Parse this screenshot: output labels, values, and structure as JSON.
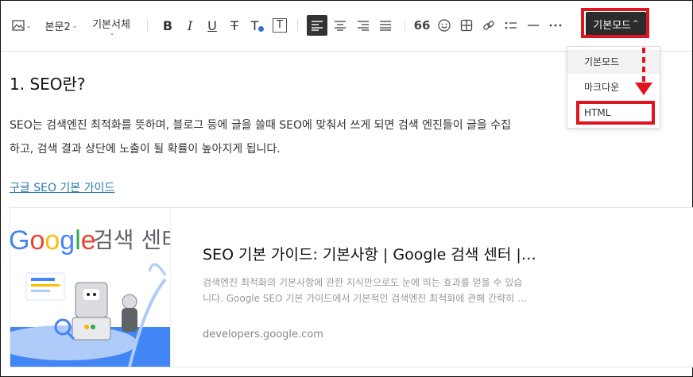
{
  "toolbar": {
    "image_icon": "image-icon",
    "paragraph_style": "본문2",
    "font_family": "기본서체",
    "bold_label": "B",
    "italic_label": "I",
    "underline_label": "U",
    "strike_label": "T",
    "text_color_label": "T",
    "text_bg_label": "T",
    "quote_label": "66",
    "mode_button": "기본모드",
    "mode_caret": "^"
  },
  "mode_menu": {
    "items": [
      {
        "label": "기본모드",
        "active": true
      },
      {
        "label": "마크다운",
        "active": false
      },
      {
        "label": "HTML",
        "active": false
      }
    ]
  },
  "colors": {
    "highlight_red": "#e0141e",
    "link_blue": "#2a7ab0",
    "mode_button_bg": "#2b2b2b",
    "text_color_dot": "#2e6fd8"
  },
  "content": {
    "heading": "1. SEO란?",
    "paragraph_line1": "SEO는 검색엔진 최적화를 뜻하며, 블로그 등에 글을 쓸때 SEO에 맞춰서 쓰게 되면  검색 엔진들이 글을 수집",
    "paragraph_line2": "하고, 검색 결과 상단에 노출이 될 확률이 높아지게 됩니다.",
    "link_text": "구글 SEO 기본 가이드"
  },
  "link_card": {
    "thumb_brand": "Google",
    "thumb_caption": "검색 센터",
    "title": "SEO 기본 가이드: 기본사항 | Google 검색 센터  |…",
    "desc_line1": "검색엔진 최적화의 기본사항에 관한 지식만으로도 눈에 띄는 효과를 얻을 수 있습",
    "desc_line2": "니다. Google SEO 기본 가이드에서 기본적인 검색엔진 최적화에 관해 간략히 …",
    "domain": "developers.google.com"
  }
}
